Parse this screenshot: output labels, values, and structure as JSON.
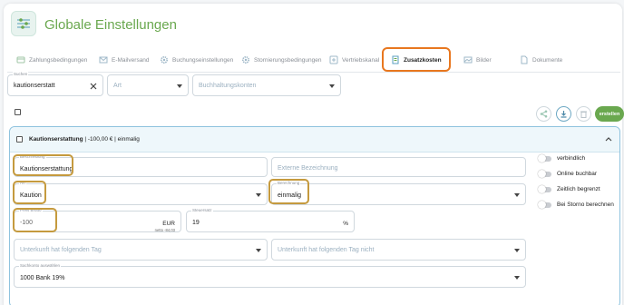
{
  "header": {
    "title": "Globale Einstellungen",
    "icon": "sliders-icon"
  },
  "tabs": [
    {
      "label": "Zahlungsbedingungen",
      "icon": "payment-icon"
    },
    {
      "label": "E-Mailversand",
      "icon": "mail-icon"
    },
    {
      "label": "Buchungseinstellungen",
      "icon": "gear-icon"
    },
    {
      "label": "Stornierungsbedingungen",
      "icon": "gear-icon"
    },
    {
      "label": "Vertriebskanal",
      "icon": "plus-box-icon"
    },
    {
      "label": "Zusatzkosten",
      "icon": "receipt-icon",
      "active": true
    },
    {
      "label": "Bilder",
      "icon": "image-icon"
    },
    {
      "label": "Dokumente",
      "icon": "document-icon"
    }
  ],
  "filters": {
    "search": {
      "label": "Suchen",
      "value": "kautionserstatt"
    },
    "art": {
      "placeholder": "Art"
    },
    "accounts": {
      "placeholder": "Buchhaltungskonten"
    }
  },
  "toolbar": {
    "create_label": "erstellen"
  },
  "item": {
    "title": "Kautionserstattung",
    "summary": " | -100,00 € | einmalig",
    "description": {
      "label": "Beschreibung",
      "value": "Kautionserstattung"
    },
    "external": {
      "placeholder": "Externe Bezeichnung"
    },
    "art": {
      "label": "Art",
      "value": "Kaution"
    },
    "berechnung": {
      "label": "Berechnung",
      "value": "einmalig"
    },
    "price": {
      "label": "Preis Brutto",
      "value": "-100",
      "currency": "EUR",
      "netto": "netto -84,03"
    },
    "tax": {
      "label": "Steuersatz",
      "value": "19",
      "unit": "%"
    },
    "tag_has": {
      "placeholder": "Unterkunft hat folgenden Tag"
    },
    "tag_not": {
      "placeholder": "Unterkunft hat folgenden Tag nicht"
    },
    "account": {
      "label": "Sachkonto auswählen",
      "value": "1000 Bank 19%"
    },
    "toggles": [
      {
        "label": "verbindlich"
      },
      {
        "label": "Online buchbar"
      },
      {
        "label": "Zeitlich begrenzt"
      },
      {
        "label": "Bei Storno berechnen"
      }
    ]
  },
  "colors": {
    "brand": "#6aa84f",
    "highlight_tab": "#e8771f",
    "highlight_field": "#c59a3e",
    "panel_border": "#8fc3de"
  }
}
